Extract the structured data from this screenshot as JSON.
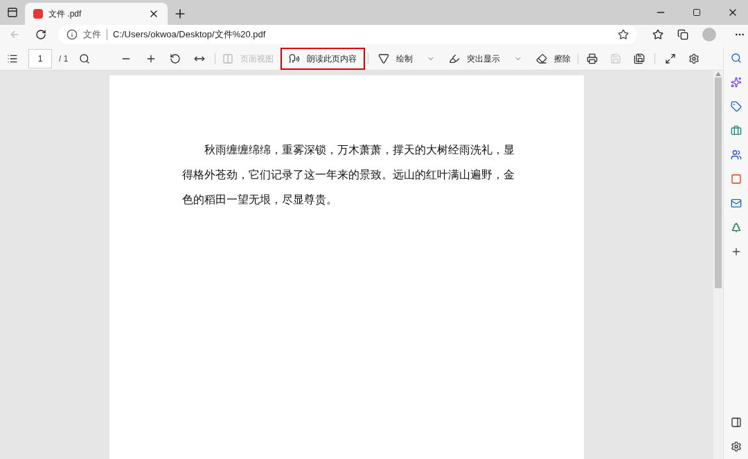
{
  "tab": {
    "title": "文件 .pdf"
  },
  "address": {
    "security_label": "文件",
    "url": "C:/Users/okwoa/Desktop/文件%20.pdf"
  },
  "pdf_toolbar": {
    "page_input": "1",
    "page_total": "/ 1",
    "save_disabled": true,
    "tools": [
      {
        "kind": "page-view",
        "label": "页面视图",
        "disabled": true,
        "highlighted": false,
        "dropdown": false
      },
      {
        "kind": "read-aloud",
        "label": "朗读此页内容",
        "disabled": false,
        "highlighted": true,
        "dropdown": false
      },
      {
        "kind": "draw",
        "label": "绘制",
        "disabled": false,
        "highlighted": false,
        "dropdown": true
      },
      {
        "kind": "highlight",
        "label": "突出显示",
        "disabled": false,
        "highlighted": false,
        "dropdown": true
      },
      {
        "kind": "erase",
        "label": "擦除",
        "disabled": false,
        "highlighted": false,
        "dropdown": false
      }
    ]
  },
  "document": {
    "paragraph": "秋雨缠缠绵绵，重雾深锁，万木萧萧，撑天的大树经雨洗礼，显得格外苍劲，它们记录了这一年来的景致。远山的红叶满山遍野，金色的稻田一望无垠，尽显尊贵。"
  }
}
